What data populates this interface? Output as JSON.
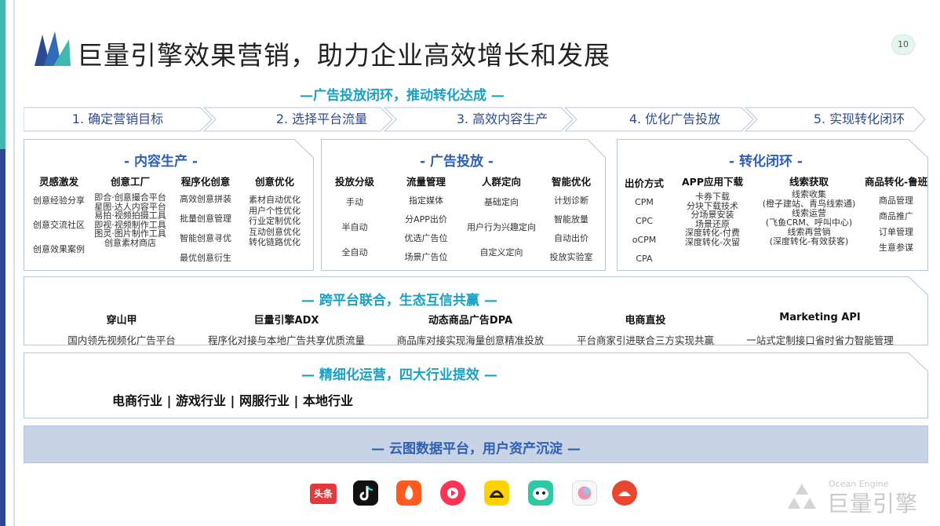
{
  "title": "巨量引擎效果营销，助力企业高效增长和发展",
  "page_number": "10",
  "closed_loop": {
    "heading": "—广告投放闭环，推动转化达成 —",
    "steps": [
      "1. 确定营销目标",
      "2. 选择平台流量",
      "3. 高效内容生产",
      "4. 优化广告投放",
      "5. 实现转化闭环"
    ]
  },
  "content_production": {
    "title": "- 内容生产 -",
    "columns": [
      {
        "header": "灵感激发",
        "items": [
          "创意经验分享",
          "创意交流社区",
          "创意效果案例"
        ]
      },
      {
        "header": "创意工厂",
        "items": [
          "即合·创意撮合平台",
          "星图·达人内容平台",
          "易拍·视频拍摄工具",
          "即视·视频制作工具",
          "图灵·图片制作工具",
          "创意素材商店"
        ]
      },
      {
        "header": "程序化创意",
        "items": [
          "高效创意拼装",
          "批量创意管理",
          "智能创意寻优",
          "最优创意衍生"
        ]
      },
      {
        "header": "创意优化",
        "items": [
          "素材自动优化",
          "用户个性优化",
          "行业定制优化",
          "互动创意优化",
          "转化链路优化"
        ]
      }
    ]
  },
  "ad_delivery": {
    "title": "- 广告投放 -",
    "columns": [
      {
        "header": "投放分级",
        "items": [
          "手动",
          "半自动",
          "全自动"
        ]
      },
      {
        "header": "流量管理",
        "items": [
          "指定媒体",
          "分APP出价",
          "优选广告位",
          "场景广告位"
        ]
      },
      {
        "header": "人群定向",
        "items": [
          "基础定向",
          "用户行为兴趣定向",
          "自定义定向"
        ]
      },
      {
        "header": "智能优化",
        "items": [
          "计划诊断",
          "智能放量",
          "自动出价",
          "投放实验室"
        ]
      }
    ]
  },
  "conversion_loop": {
    "title": "- 转化闭环 -",
    "columns": [
      {
        "header": "出价方式",
        "items": [
          "CPM",
          "CPC",
          "oCPM",
          "CPA"
        ]
      },
      {
        "header": "APP应用下载",
        "items": [
          "卡券下载",
          "分块下载技术",
          "分场景安装",
          "场景还原",
          "深度转化-付费",
          "深度转化-次留"
        ]
      },
      {
        "header": "线索获取",
        "items": [
          "线索收集",
          "(橙子建站、青鸟线索通)",
          "线索运营",
          "(飞鱼CRM、呼叫中心)",
          "线索再营销",
          "(深度转化-有效获客)"
        ]
      },
      {
        "header": "商品转化-鲁班",
        "items": [
          "商品管理",
          "商品推广",
          "订单管理",
          "生意参谋"
        ]
      }
    ]
  },
  "cross_platform": {
    "heading": "— 跨平台联合，生态互信共赢 —",
    "items": [
      {
        "name": "穿山甲",
        "desc": "国内领先视频化广告平台"
      },
      {
        "name": "巨量引擎ADX",
        "desc": "程序化对接与本地广告共享优质流量"
      },
      {
        "name": "动态商品广告DPA",
        "desc": "商品库对接实现海量创意精准投放"
      },
      {
        "name": "电商直投",
        "desc": "平台商家引进联合三方实现共赢"
      },
      {
        "name": "Marketing API",
        "desc": "一站式定制接口省时省力智能管理"
      }
    ]
  },
  "operations": {
    "heading": "— 精细化运营，四大行业提效 —",
    "industries": "电商行业  |  游戏行业  |  网服行业  |  本地行业"
  },
  "cloud": {
    "heading": "— 云图数据平台，用户资产沉淀 —"
  },
  "apps": [
    {
      "icon": "toutiao-icon",
      "label": "头条",
      "color": "#e4393c"
    },
    {
      "icon": "douyin-icon",
      "label": "",
      "color": "#111111"
    },
    {
      "icon": "huoshan-icon",
      "label": "",
      "color": "#ff5a1f"
    },
    {
      "icon": "xigua-icon",
      "label": "",
      "color": "#ff3355"
    },
    {
      "icon": "dongchedi-icon",
      "label": "",
      "color": "#ffd200"
    },
    {
      "icon": "pipixia-icon",
      "label": "",
      "color": "#2fc8a5"
    },
    {
      "icon": "qingyan-icon",
      "label": "",
      "color": "#f4a7c8"
    },
    {
      "icon": "aweme-icon",
      "label": "",
      "color": "#e8472f"
    }
  ],
  "brand": {
    "small": "Ocean Engine",
    "big": "巨量引擎"
  },
  "colors": {
    "accent_teal": "#1aa0c2",
    "accent_blue": "#2d5fb3",
    "dark_blue": "#2c4a93",
    "band_blue": "#c9d3e6"
  }
}
